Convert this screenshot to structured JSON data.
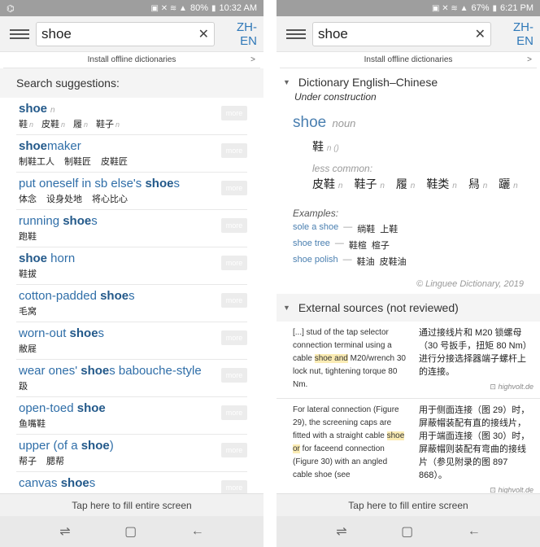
{
  "colors": {
    "accent": "#2f78b8",
    "statusbar": "#9e9e9e",
    "highlight": "#fbecb4"
  },
  "left": {
    "status": {
      "battery": "80%",
      "time": "10:32 AM"
    },
    "search": {
      "value": "shoe",
      "lang": "ZH-EN"
    },
    "install_label": "Install offline dictionaries",
    "install_chev": ">",
    "suggestions_header": "Search suggestions:",
    "more_label": "more",
    "suggestions": [
      {
        "pre": "",
        "bold": "shoe",
        "post": "",
        "pos": "n",
        "trans": [
          [
            "鞋",
            "n"
          ],
          [
            "皮鞋",
            "n"
          ],
          [
            "履",
            "n"
          ],
          [
            "鞋子",
            "n"
          ]
        ]
      },
      {
        "pre": "",
        "bold": "shoe",
        "post": "maker",
        "pos": "",
        "trans": [
          [
            "制鞋工人",
            ""
          ],
          [
            "制鞋匠",
            ""
          ],
          [
            "皮鞋匠",
            ""
          ]
        ]
      },
      {
        "pre": "put oneself in sb else's ",
        "bold": "shoe",
        "post": "s",
        "pos": "",
        "trans": [
          [
            "体念",
            ""
          ],
          [
            "设身处地",
            ""
          ],
          [
            "将心比心",
            ""
          ]
        ]
      },
      {
        "pre": "running ",
        "bold": "shoe",
        "post": "s",
        "pos": "",
        "trans": [
          [
            "跑鞋",
            ""
          ]
        ]
      },
      {
        "pre": "",
        "bold": "shoe",
        "post": " horn",
        "pos": "",
        "trans": [
          [
            "鞋拔",
            ""
          ]
        ]
      },
      {
        "pre": "cotton-padded ",
        "bold": "shoe",
        "post": "s",
        "pos": "",
        "trans": [
          [
            "毛窝",
            ""
          ]
        ]
      },
      {
        "pre": "worn-out ",
        "bold": "shoe",
        "post": "s",
        "pos": "",
        "trans": [
          [
            "敝屣",
            ""
          ]
        ]
      },
      {
        "pre": "wear ones' ",
        "bold": "shoe",
        "post": "s babouche-style",
        "pos": "",
        "trans": [
          [
            "趿",
            ""
          ]
        ]
      },
      {
        "pre": "open-toed ",
        "bold": "shoe",
        "post": "",
        "pos": "",
        "trans": [
          [
            "鱼嘴鞋",
            ""
          ]
        ]
      },
      {
        "pre": "upper (of a ",
        "bold": "shoe",
        "post": ")",
        "pos": "",
        "trans": [
          [
            "帮子",
            ""
          ],
          [
            "腮帮",
            ""
          ]
        ]
      },
      {
        "pre": "canvas ",
        "bold": "shoe",
        "post": "s",
        "pos": "",
        "trans": []
      }
    ],
    "fill_label": "Tap here to fill entire screen"
  },
  "right": {
    "status": {
      "battery": "67%",
      "time": "6:21 PM"
    },
    "search": {
      "value": "shoe",
      "lang": "ZH-EN"
    },
    "install_label": "Install offline dictionaries",
    "install_chev": ">",
    "dict_title": "Dictionary English–Chinese",
    "dict_sub": "Under construction",
    "headword": "shoe",
    "headword_pos": "noun",
    "main_trans": "鞋",
    "main_trans_pos": "n ()",
    "less_common_label": "less common:",
    "less_common": [
      [
        "皮鞋",
        "n"
      ],
      [
        "鞋子",
        "n"
      ],
      [
        "履",
        "n"
      ],
      [
        "鞋类",
        "n"
      ],
      [
        "舄",
        "n"
      ],
      [
        "躧",
        "n"
      ]
    ],
    "examples_label": "Examples:",
    "examples": [
      {
        "en": "sole a shoe",
        "zh": [
          "绱鞋",
          "上鞋"
        ]
      },
      {
        "en": "shoe tree",
        "zh": [
          "鞋楦",
          "楦子"
        ]
      },
      {
        "en": "shoe polish",
        "zh": [
          "鞋油",
          "皮鞋油"
        ]
      }
    ],
    "copyright": "© Linguee Dictionary, 2019",
    "external_title": "External sources (not reviewed)",
    "external": [
      {
        "en_before": "[...] stud of the tap selector connection terminal using a cable ",
        "en_hl": "shoe and",
        "en_after": " M20/wrench 30 lock nut, tightening torque 80 Nm.",
        "zh": "通过接线片和 M20 锁螺母（30 号扳手，扭矩 80 Nm）进行分接选择器端子螺杆上的连接。",
        "src": "highvolt.de"
      },
      {
        "en_before": "For lateral connection (Figure 29), the screening caps are fitted with a straight cable ",
        "en_hl": "shoe or",
        "en_after": " for faceend connection (Figure 30) with an angled cable shoe (see",
        "zh": "用于侧面连接（图 29）时，屏蔽帽装配有直的接线片，用于端面连接（图 30）时，屏蔽帽则装配有弯曲的接线片（参见附录的图 897 868）。",
        "src": "highvolt.de"
      }
    ],
    "fill_label": "Tap here to fill entire screen"
  }
}
